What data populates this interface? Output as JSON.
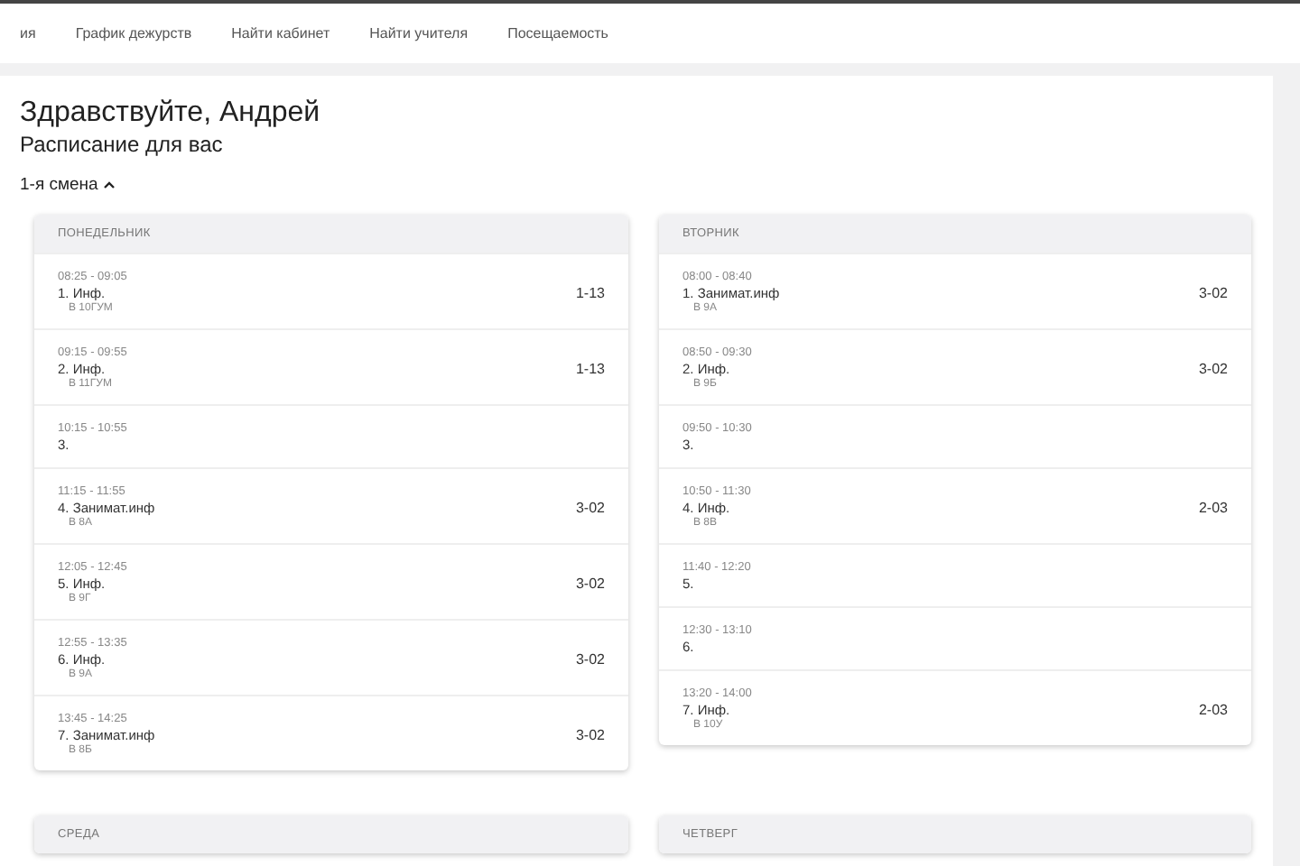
{
  "nav": {
    "items": [
      {
        "label": "ия"
      },
      {
        "label": "График дежурств"
      },
      {
        "label": "Найти кабинет"
      },
      {
        "label": "Найти учителя"
      },
      {
        "label": "Посещаемость"
      }
    ]
  },
  "greeting": "Здравствуйте, Андрей",
  "subtitle": "Расписание для вас",
  "shift": {
    "label": "1-я смена",
    "expanded": true
  },
  "days": [
    {
      "name": "ПОНЕДЕЛЬНИК",
      "lessons": [
        {
          "time": "08:25 - 09:05",
          "title": "1. Инф.",
          "class": "В 10ГУМ",
          "room": "1-13"
        },
        {
          "time": "09:15 - 09:55",
          "title": "2. Инф.",
          "class": "В 11ГУМ",
          "room": "1-13"
        },
        {
          "time": "10:15 - 10:55",
          "title": "3."
        },
        {
          "time": "11:15 - 11:55",
          "title": "4. Занимат.инф",
          "class": "В 8А",
          "room": "3-02"
        },
        {
          "time": "12:05 - 12:45",
          "title": "5. Инф.",
          "class": "В 9Г",
          "room": "3-02"
        },
        {
          "time": "12:55 - 13:35",
          "title": "6. Инф.",
          "class": "В 9А",
          "room": "3-02"
        },
        {
          "time": "13:45 - 14:25",
          "title": "7. Занимат.инф",
          "class": "В 8Б",
          "room": "3-02"
        }
      ]
    },
    {
      "name": "ВТОРНИК",
      "lessons": [
        {
          "time": "08:00 - 08:40",
          "title": "1. Занимат.инф",
          "class": "В 9А",
          "room": "3-02"
        },
        {
          "time": "08:50 - 09:30",
          "title": "2. Инф.",
          "class": "В 9Б",
          "room": "3-02"
        },
        {
          "time": "09:50 - 10:30",
          "title": "3."
        },
        {
          "time": "10:50 - 11:30",
          "title": "4. Инф.",
          "class": "В 8В",
          "room": "2-03"
        },
        {
          "time": "11:40 - 12:20",
          "title": "5."
        },
        {
          "time": "12:30 - 13:10",
          "title": "6."
        },
        {
          "time": "13:20 - 14:00",
          "title": "7. Инф.",
          "class": "В 10У",
          "room": "2-03"
        }
      ]
    },
    {
      "name": "СРЕДА"
    },
    {
      "name": "ЧЕТВЕРГ"
    }
  ]
}
